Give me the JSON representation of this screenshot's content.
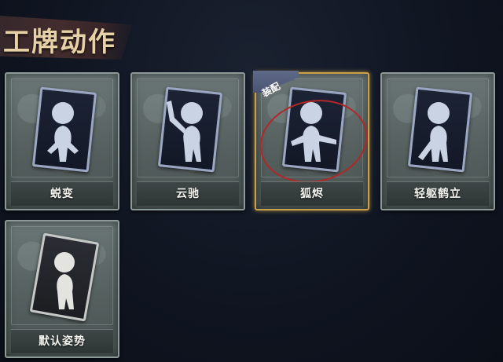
{
  "header": {
    "title": "工牌动作"
  },
  "cards": [
    {
      "label": "蜕变",
      "equipped": false,
      "style": "blue"
    },
    {
      "label": "云驰",
      "equipped": false,
      "style": "blue"
    },
    {
      "label": "狐烬",
      "equipped": true,
      "style": "blue",
      "tag": "装配"
    },
    {
      "label": "轻躯鹤立",
      "equipped": false,
      "style": "blue"
    },
    {
      "label": "默认姿势",
      "equipped": false,
      "style": "default"
    }
  ],
  "colors": {
    "accent_gold": "#c9a14a",
    "title_color": "#e6d2a6",
    "marker_red": "#b02828",
    "tag_bg": "#5f6a88"
  }
}
